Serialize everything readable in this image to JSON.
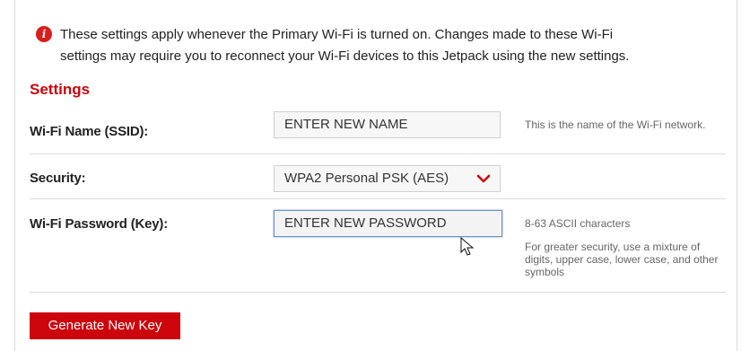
{
  "notice": {
    "icon": "info-icon",
    "icon_glyph": "i",
    "line1": "These settings apply whenever the Primary Wi-Fi is turned on. Changes made to these Wi-Fi",
    "line2": "settings may require you to reconnect your Wi-Fi devices to this Jetpack using the new settings."
  },
  "section_title": "Settings",
  "fields": {
    "ssid": {
      "label": "Wi-Fi Name (SSID):",
      "value": "ENTER NEW NAME",
      "hint": "This is the name of the Wi-Fi network."
    },
    "security": {
      "label": "Security:",
      "value": "WPA2 Personal PSK (AES)",
      "icon": "chevron-down-icon"
    },
    "password": {
      "label": "Wi-Fi Password (Key):",
      "value": "ENTER NEW PASSWORD",
      "hint1": "8-63 ASCII characters",
      "hint2": "For greater security, use a mixture of digits, upper case, lower case, and other symbols"
    }
  },
  "generate_button": "Generate New Key",
  "colors": {
    "accent": "#cd040b",
    "focus_border": "#6a92c4",
    "hint_text": "#666666"
  }
}
